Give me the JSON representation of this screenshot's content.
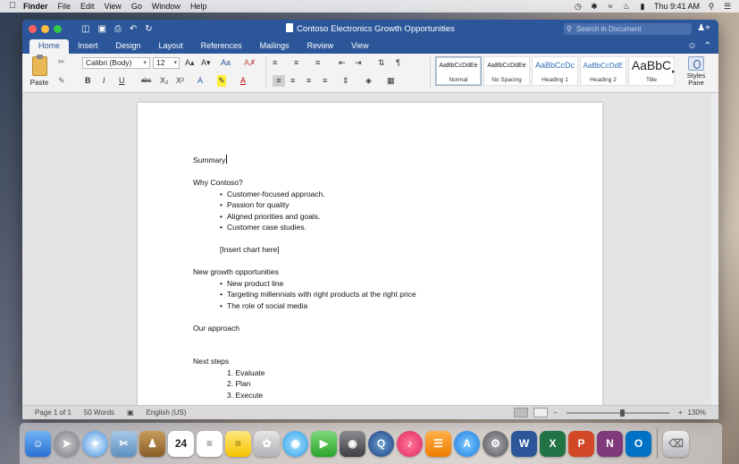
{
  "menubar": {
    "app": "Finder",
    "items": [
      "File",
      "Edit",
      "View",
      "Go",
      "Window",
      "Help"
    ],
    "clock": "Thu 9:41 AM",
    "status_icons": [
      "time-machine-icon",
      "bluetooth-icon",
      "wifi-icon",
      "volume-icon",
      "battery-icon"
    ]
  },
  "window": {
    "title": "Contoso Electronics Growth Opportunities",
    "search_placeholder": "Search in Document",
    "tabs": [
      "Home",
      "Insert",
      "Design",
      "Layout",
      "References",
      "Mailings",
      "Review",
      "View"
    ],
    "active_tab": "Home"
  },
  "ribbon": {
    "paste_label": "Paste",
    "font_name": "Calibri (Body)",
    "font_size": "12",
    "styles": [
      {
        "sample": "AaBbCcDdEe",
        "name": "Normal"
      },
      {
        "sample": "AaBbCcDdEe",
        "name": "No Spacing"
      },
      {
        "sample": "AaBbCcDc",
        "name": "Heading 1"
      },
      {
        "sample": "AaBbCcDdE",
        "name": "Heading 2"
      },
      {
        "sample": "AaBbC",
        "name": "Title"
      }
    ],
    "styles_pane_label": "Styles Pane",
    "accent": "#2b579a"
  },
  "document": {
    "summary": "Summary",
    "why_heading": "Why Contoso?",
    "why_bullets": [
      "Customer-focused approach.",
      "Passion for quality",
      "Aligned priorities and goals.",
      "Customer case studies."
    ],
    "chart_placeholder": "[Insert chart here]",
    "growth_heading": "New growth opportunities",
    "growth_bullets": [
      "New product line",
      "Targeting millennials with right products at the right price",
      "The role of social media"
    ],
    "approach_heading": "Our approach",
    "next_heading": "Next steps",
    "next_steps": [
      "1. Evaluate",
      "2. Plan",
      "3. Execute"
    ]
  },
  "status": {
    "page": "Page 1 of 1",
    "words": "50 Words",
    "language": "English (US)",
    "zoom": "130%",
    "zoom_fraction": 0.55
  },
  "dock": {
    "apps": [
      "finder",
      "launchpad",
      "safari",
      "mail-preview",
      "contacts",
      "calendar",
      "reminders",
      "notes",
      "photos",
      "messages",
      "facetime",
      "photo-booth",
      "quicktime",
      "itunes",
      "ibooks",
      "app-store",
      "system-preferences",
      "word",
      "excel",
      "powerpoint",
      "onenote",
      "outlook",
      "trash"
    ],
    "calendar_day": "24"
  }
}
